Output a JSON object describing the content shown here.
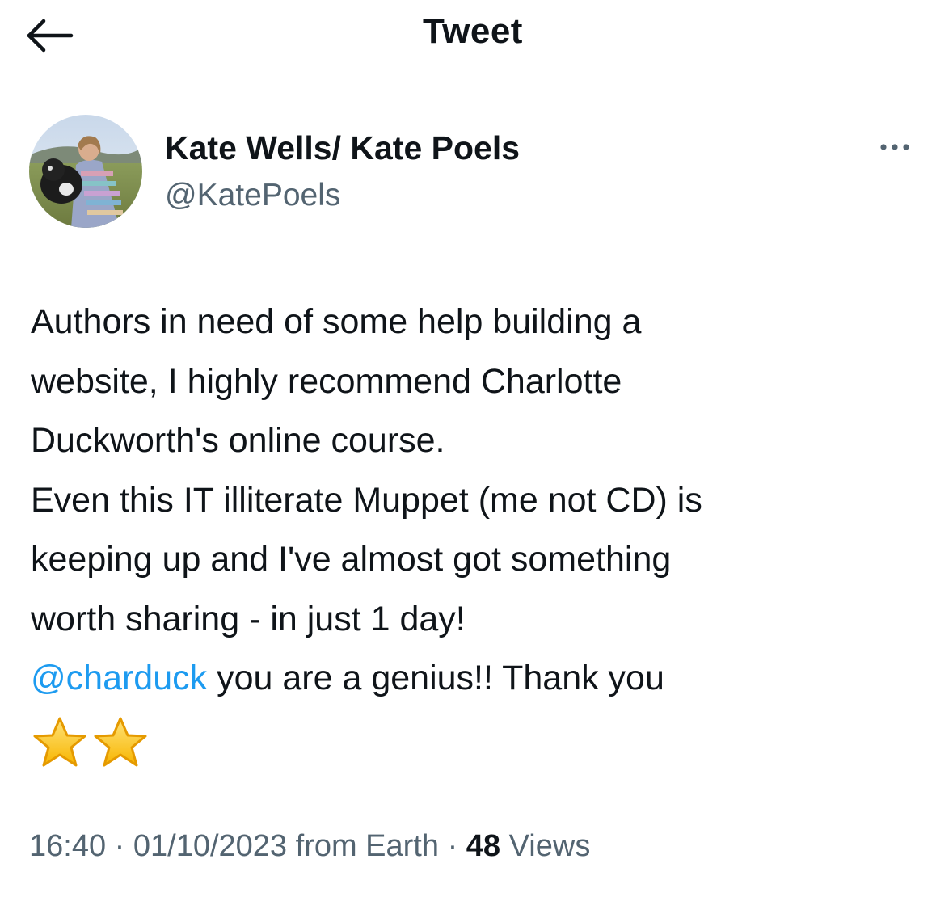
{
  "header": {
    "title": "Tweet",
    "back_icon": "arrow-left-icon"
  },
  "author": {
    "display_name": "Kate Wells/ Kate Poels",
    "handle": "@KatePoels",
    "more_icon": "more-horizontal-icon"
  },
  "tweet": {
    "lines": [
      "Authors in need of some help building a",
      "website, I highly recommend Charlotte",
      "Duckworth's online course.",
      "Even this IT illiterate Muppet (me not CD) is",
      "keeping up and I've almost got something",
      "worth sharing - in just 1 day!"
    ],
    "mention": "@charduck",
    "mention_rest": " you are a genius!! Thank you",
    "emoji": "star-emoji-icon",
    "link_color": "#1d9bf0"
  },
  "meta": {
    "time": "16:40",
    "sep1": " · ",
    "date": "01/10/2023",
    "source": " from Earth",
    "sep2": " · ",
    "views_count": "48",
    "views_label": " Views"
  }
}
